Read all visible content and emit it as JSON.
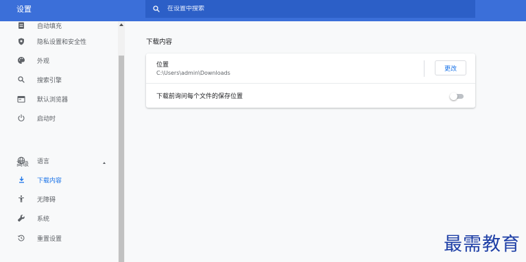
{
  "app": {
    "title": "设置"
  },
  "search": {
    "placeholder": "在设置中搜索"
  },
  "sidebar": {
    "items": [
      {
        "label": "自动填充",
        "icon": "clipboard-icon"
      },
      {
        "label": "隐私设置和安全性",
        "icon": "shield-icon"
      },
      {
        "label": "外观",
        "icon": "palette-icon"
      },
      {
        "label": "搜索引擎",
        "icon": "search-icon"
      },
      {
        "label": "默认浏览器",
        "icon": "browser-icon"
      },
      {
        "label": "启动时",
        "icon": "power-icon"
      }
    ],
    "advanced": {
      "label": "高级",
      "items": [
        {
          "label": "语言",
          "icon": "globe-icon"
        },
        {
          "label": "下载内容",
          "icon": "download-icon",
          "active": true
        },
        {
          "label": "无障碍",
          "icon": "accessibility-icon"
        },
        {
          "label": "系统",
          "icon": "wrench-icon"
        },
        {
          "label": "重置设置",
          "icon": "history-icon"
        }
      ]
    }
  },
  "main": {
    "section_title": "下载内容",
    "location": {
      "label": "位置",
      "path": "C:\\Users\\admin\\Downloads",
      "button_label": "更改"
    },
    "ask_where": {
      "label": "下载前询问每个文件的保存位置",
      "enabled": false
    }
  },
  "watermark": {
    "text": "最需教育"
  },
  "colors": {
    "header": "#3b6fd9",
    "search_bg": "#2c5fc7",
    "accent": "#1a73e8",
    "watermark": "#1e3fa6"
  }
}
